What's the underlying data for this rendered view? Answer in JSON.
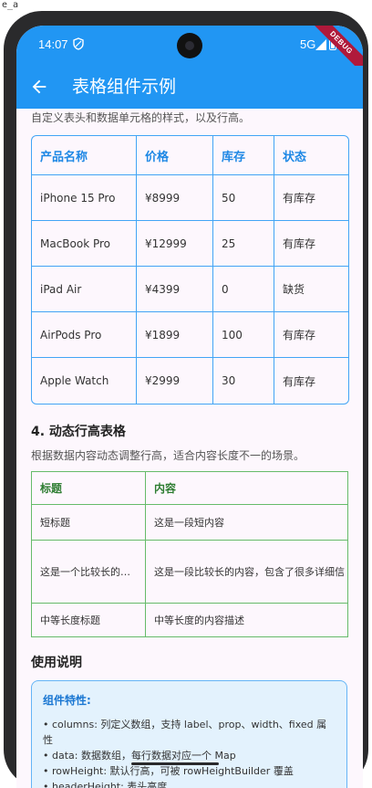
{
  "topline": "e_a",
  "status": {
    "time": "14:07",
    "network": "5G",
    "debug": "DEBUG"
  },
  "appbar": {
    "title": "表格组件示例"
  },
  "section3": {
    "description": "自定义表头和数据单元格的样式，以及行高。"
  },
  "product_table": {
    "headers": [
      "产品名称",
      "价格",
      "库存",
      "状态"
    ],
    "rows": [
      [
        "iPhone 15 Pro",
        "¥8999",
        "50",
        "有库存"
      ],
      [
        "MacBook Pro",
        "¥12999",
        "25",
        "有库存"
      ],
      [
        "iPad Air",
        "¥4399",
        "0",
        "缺货"
      ],
      [
        "AirPods Pro",
        "¥1899",
        "100",
        "有库存"
      ],
      [
        "Apple Watch",
        "¥2999",
        "30",
        "有库存"
      ]
    ]
  },
  "section4": {
    "title": "4. 动态行高表格",
    "description": "根据数据内容动态调整行高，适合内容长度不一的场景。"
  },
  "dynamic_table": {
    "headers": [
      "标题",
      "内容"
    ],
    "rows": [
      [
        "短标题",
        "这是一段短内容"
      ],
      [
        "这是一个比较长的…",
        "这是一段比较长的内容，包含了很多详细信"
      ],
      [
        "中等长度标题",
        "中等长度的内容描述"
      ]
    ]
  },
  "usage": {
    "heading": "使用说明",
    "title": "组件特性:",
    "items": [
      "• columns: 列定义数组，支持 label、prop、width、fixed 属性",
      "• data: 数据数组，每行数据对应一个 Map",
      "• rowHeight: 默认行高，可被 rowHeightBuilder 覆盖",
      "• headerHeight: 表头高度"
    ]
  },
  "colors": {
    "primary": "#2196f3",
    "table_blue": "#42a5f5",
    "table_green": "#66bb6a"
  }
}
